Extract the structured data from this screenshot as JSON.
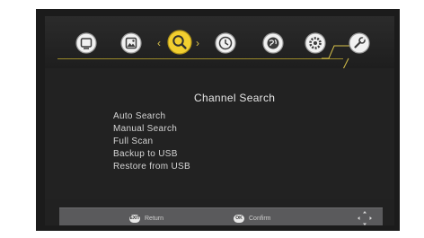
{
  "menu": {
    "title": "Channel Search",
    "items": [
      "Auto Search",
      "Manual Search",
      "Full Scan",
      "Backup to USB",
      "Restore from USB"
    ],
    "selected_tab": "channel-search"
  },
  "tabs": {
    "icons": [
      "program-icon",
      "picture-icon",
      "search-icon",
      "time-icon",
      "language-icon",
      "settings-icon",
      "tools-icon"
    ]
  },
  "footer": {
    "return_label": "Return",
    "confirm_label": "Confirm",
    "return_key": "EXIT",
    "confirm_key": "OK"
  },
  "colors": {
    "accent_gold": "#d8c24a",
    "background": "#212121",
    "footer_bar": "#5a5a5c"
  }
}
